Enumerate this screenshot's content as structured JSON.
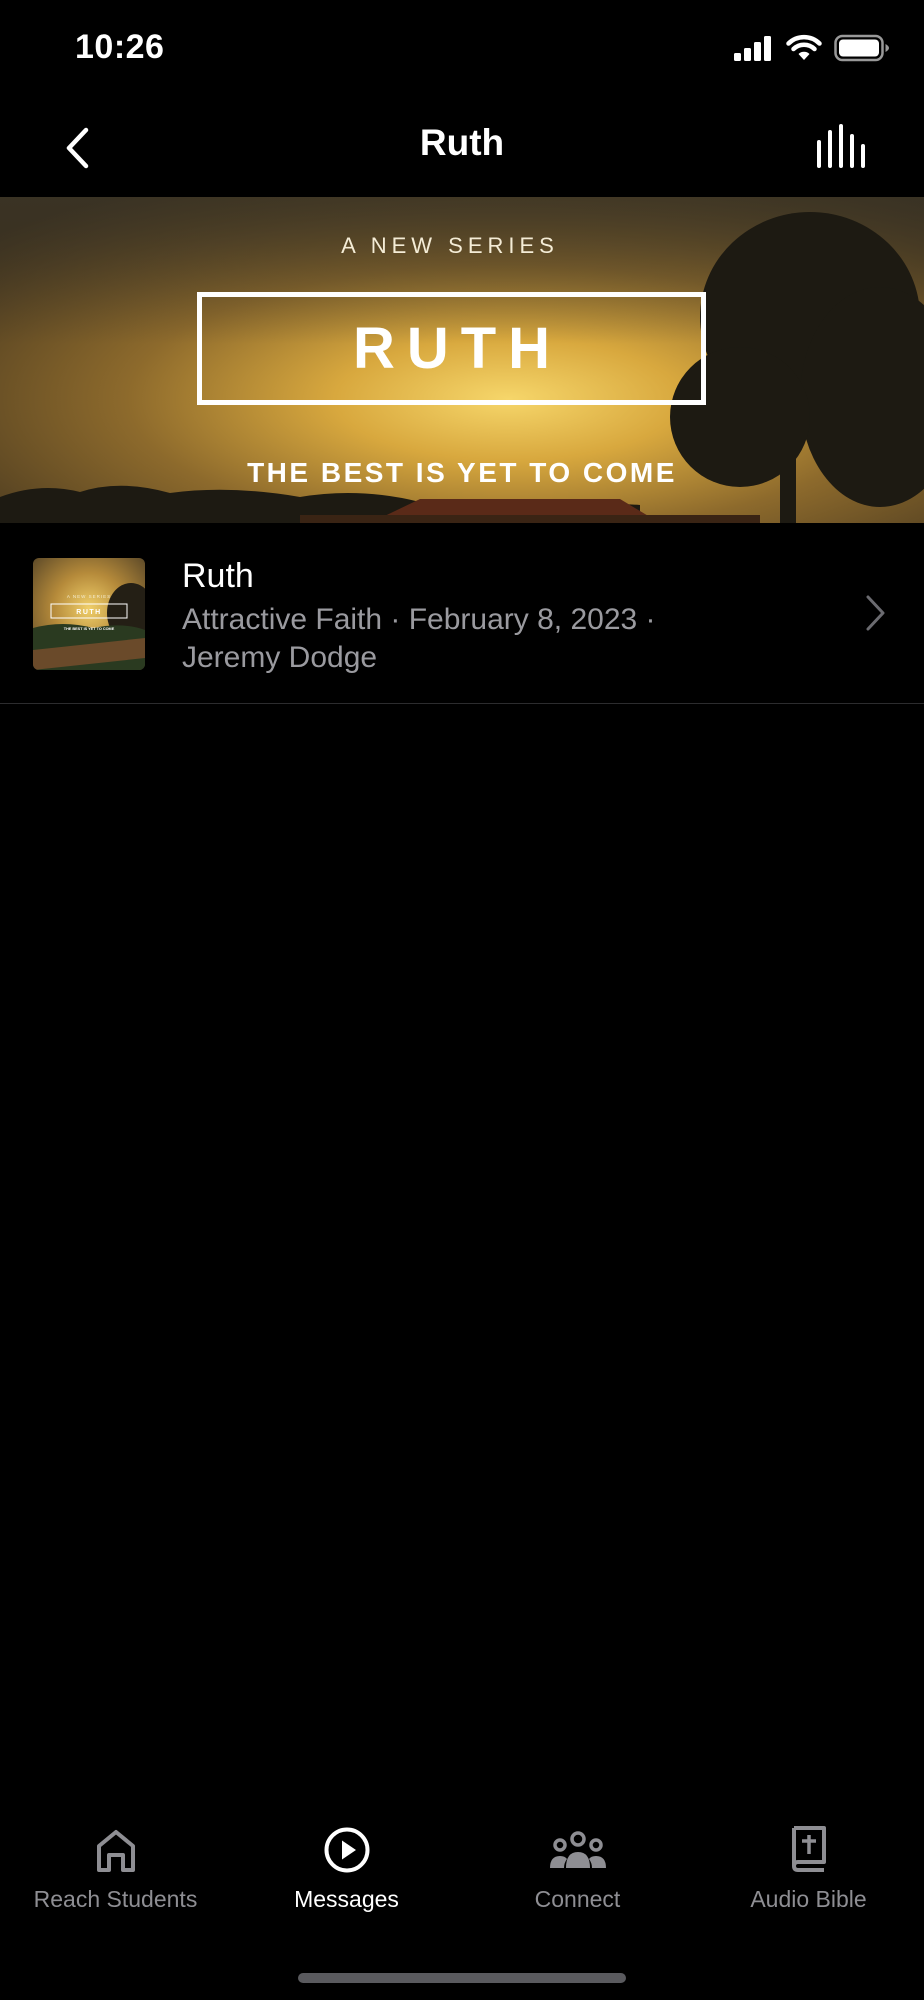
{
  "status_bar": {
    "time": "10:26",
    "icons": [
      "signal-icon",
      "wifi-icon",
      "battery-icon"
    ]
  },
  "nav": {
    "title": "Ruth",
    "back_icon": "chevron-left-icon",
    "audio_icon": "audio-bars-icon"
  },
  "banner": {
    "kicker": "A NEW SERIES",
    "title": "RUTH",
    "tagline": "THE BEST IS YET TO COME"
  },
  "messages": [
    {
      "title": "Ruth",
      "meta_line1": "Attractive Faith · February 8, 2023 ·",
      "meta_line2": "Jeremy Dodge",
      "thumbnail": {
        "kicker": "A NEW SERIES",
        "title": "RUTH",
        "tagline": "THE BEST IS YET TO COME"
      }
    }
  ],
  "tabs": [
    {
      "label": "Reach Students",
      "icon": "home-icon",
      "active": false
    },
    {
      "label": "Messages",
      "icon": "play-circle-icon",
      "active": true
    },
    {
      "label": "Connect",
      "icon": "people-icon",
      "active": false
    },
    {
      "label": "Audio Bible",
      "icon": "bible-icon",
      "active": false
    }
  ],
  "colors": {
    "background": "#000000",
    "tab_inactive": "#8e8e93",
    "tab_active": "#ffffff",
    "meta_text": "#9a9a9f",
    "divider": "#2c2c2e"
  }
}
